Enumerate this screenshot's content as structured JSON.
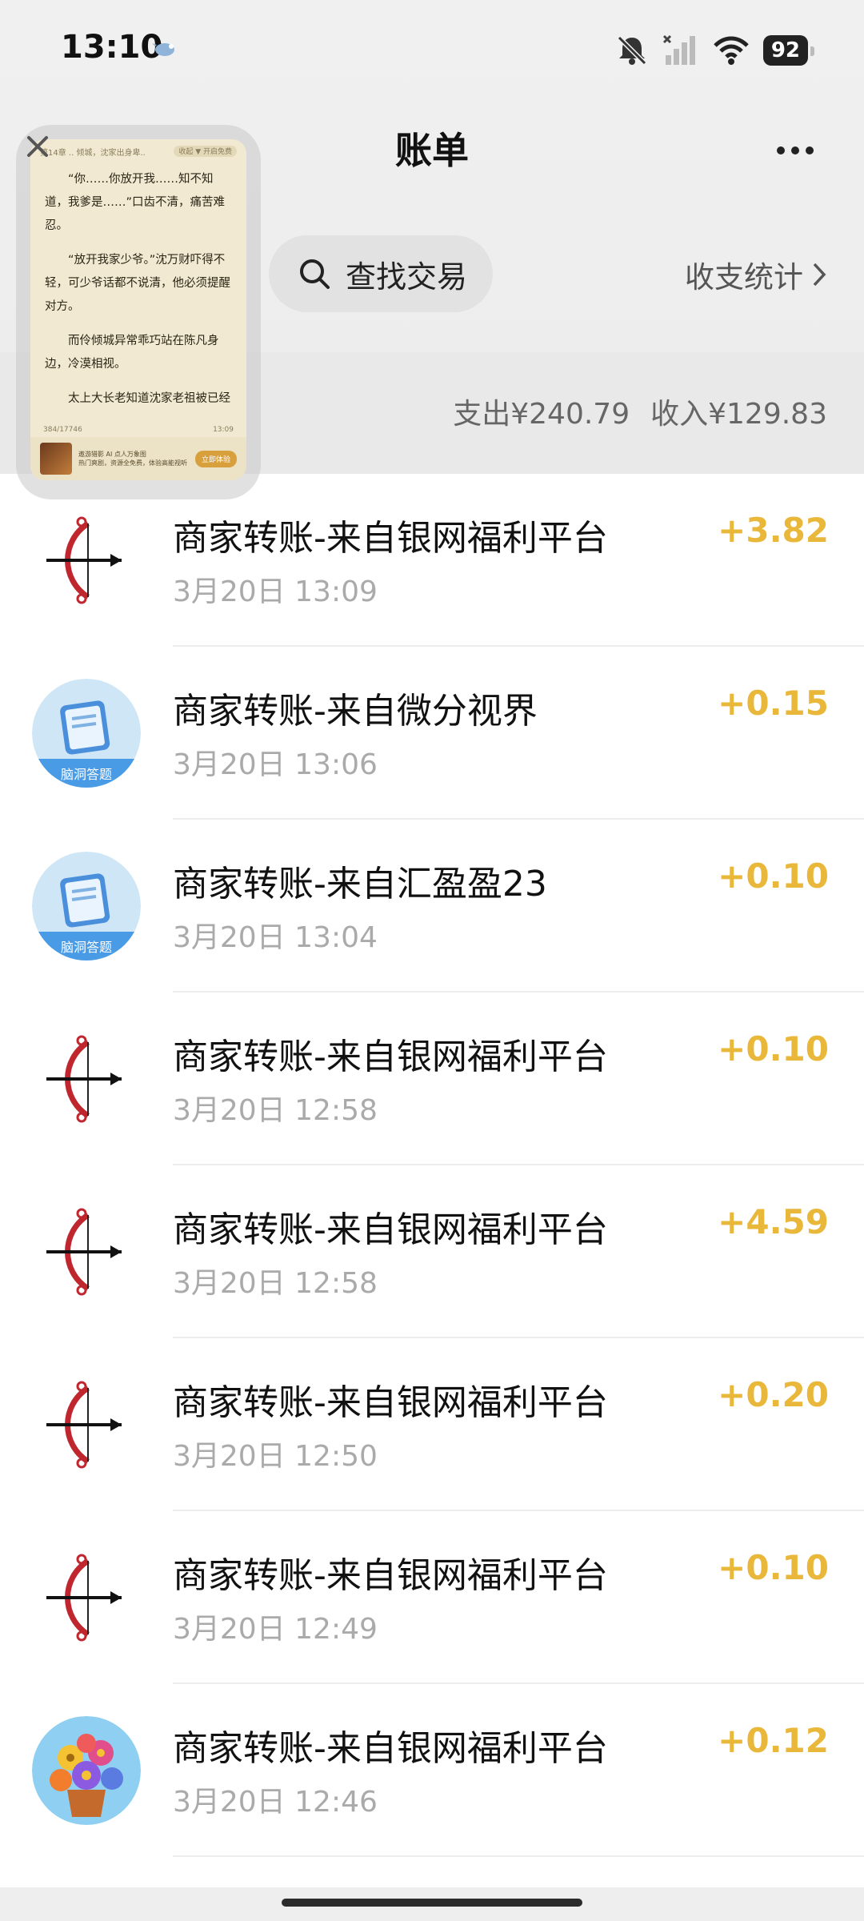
{
  "status_bar": {
    "time": "13:10",
    "battery": "92",
    "icons": [
      "mute-icon",
      "signal-icon",
      "wifi-icon",
      "battery-icon"
    ]
  },
  "nav": {
    "title": "账单",
    "more_icon": "more-icon"
  },
  "search": {
    "label": "查找交易"
  },
  "stats_link": {
    "label": "收支统计"
  },
  "summary": {
    "expense": "支出¥240.79",
    "income": "收入¥129.83"
  },
  "floating_window": {
    "top_text": "第14章 .. 倾城，沈家出身卑..",
    "chip": "收起 ▼ 开启免费",
    "paragraphs": [
      "“你……你放开我……知不知道，我爹是……”口齿不清，痛苦难忍。",
      "“放开我家少爷。”沈万财吓得不轻，可少爷话都不说清，他必须提醒对方。",
      "而伶倾城异常乖巧站在陈凡身边，冷漠相视。",
      "太上大长老知道沈家老祖被已经"
    ],
    "progress": "384/17746",
    "clock": "13:09",
    "ad_title": "遨游猎影 AI 点人万象图",
    "ad_desc": "热门爽剧，资源全免费，体验高能视听",
    "ad_button": "立即体验"
  },
  "transactions": [
    {
      "title": "商家转账-来自银网福利平台",
      "time": "3月20日 13:09",
      "amount": "+3.82",
      "avatar": "bow-arrow-icon"
    },
    {
      "title": "商家转账-来自微分视界",
      "time": "3月20日 13:06",
      "amount": "+0.15",
      "avatar": "book-quiz-icon",
      "avatar_caption": "脑洞答题"
    },
    {
      "title": "商家转账-来自汇盈盈23",
      "time": "3月20日 13:04",
      "amount": "+0.10",
      "avatar": "book-quiz-icon",
      "avatar_caption": "脑洞答题"
    },
    {
      "title": "商家转账-来自银网福利平台",
      "time": "3月20日 12:58",
      "amount": "+0.10",
      "avatar": "bow-arrow-icon"
    },
    {
      "title": "商家转账-来自银网福利平台",
      "time": "3月20日 12:58",
      "amount": "+4.59",
      "avatar": "bow-arrow-icon"
    },
    {
      "title": "商家转账-来自银网福利平台",
      "time": "3月20日 12:50",
      "amount": "+0.20",
      "avatar": "bow-arrow-icon"
    },
    {
      "title": "商家转账-来自银网福利平台",
      "time": "3月20日 12:49",
      "amount": "+0.10",
      "avatar": "bow-arrow-icon"
    },
    {
      "title": "商家转账-来自银网福利平台",
      "time": "3月20日 12:46",
      "amount": "+0.12",
      "avatar": "flower-pot-icon"
    }
  ],
  "colors": {
    "amount": "#e9b73a",
    "background_top": "#ececec",
    "list_background": "#ffffff"
  }
}
